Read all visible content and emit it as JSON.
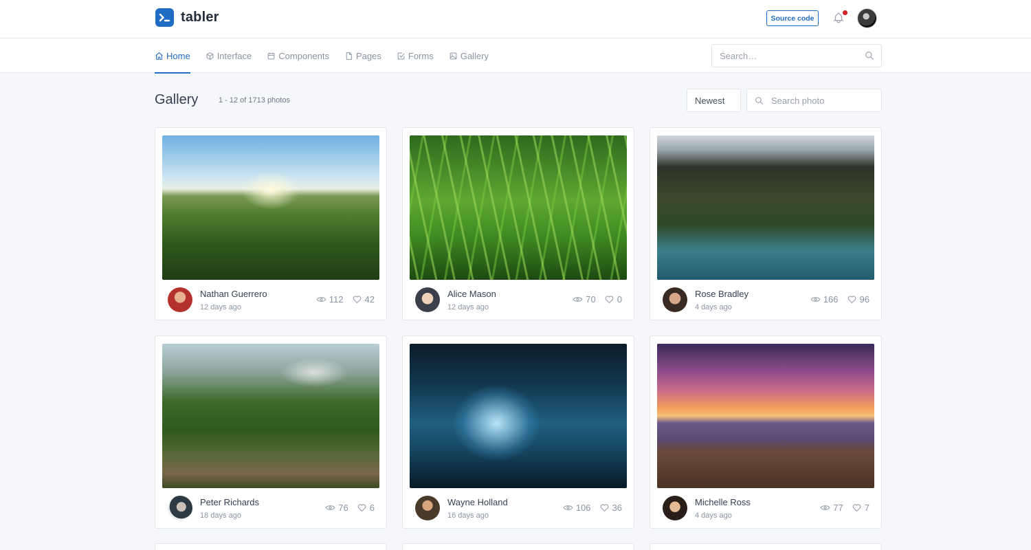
{
  "header": {
    "brand": "tabler",
    "source_code_label": "Source code"
  },
  "nav": {
    "items": [
      {
        "label": "Home",
        "icon": "home-icon",
        "active": true
      },
      {
        "label": "Interface",
        "icon": "box-icon"
      },
      {
        "label": "Components",
        "icon": "calendar-icon"
      },
      {
        "label": "Pages",
        "icon": "file-icon"
      },
      {
        "label": "Forms",
        "icon": "check-square-icon"
      },
      {
        "label": "Gallery",
        "icon": "image-icon"
      }
    ],
    "search_placeholder": "Search…"
  },
  "page": {
    "title": "Gallery",
    "count": "1 - 12 of 1713 photos",
    "sort_selected": "Newest",
    "photo_search_placeholder": "Search photo"
  },
  "cards": [
    {
      "author": "Nathan Guerrero",
      "time": "12 days ago",
      "views": "112",
      "likes": "42"
    },
    {
      "author": "Alice Mason",
      "time": "12 days ago",
      "views": "70",
      "likes": "0"
    },
    {
      "author": "Rose Bradley",
      "time": "4 days ago",
      "views": "166",
      "likes": "96"
    },
    {
      "author": "Peter Richards",
      "time": "18 days ago",
      "views": "76",
      "likes": "6"
    },
    {
      "author": "Wayne Holland",
      "time": "16 days ago",
      "views": "106",
      "likes": "36"
    },
    {
      "author": "Michelle Ross",
      "time": "4 days ago",
      "views": "77",
      "likes": "7"
    }
  ],
  "colors": {
    "primary": "#206bc4",
    "notification": "#cd201f",
    "background": "#f5f7fb"
  }
}
